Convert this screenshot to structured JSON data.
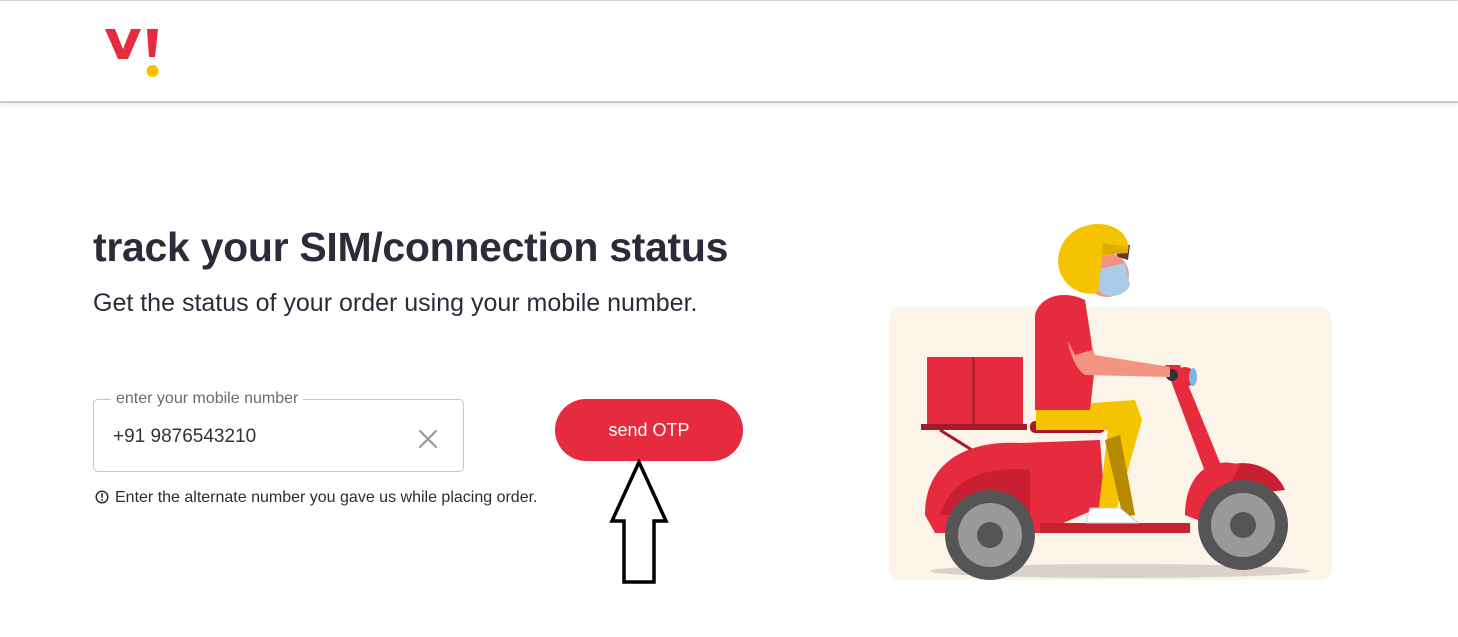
{
  "header": {
    "logo_icon": "vi-logo-icon",
    "brand_colors": {
      "red": "#e52b3d",
      "yellow": "#fdbf00"
    }
  },
  "main": {
    "title": "track your SIM/connection status",
    "subtitle": "Get the status of your order using your mobile number.",
    "mobile_field": {
      "label": "enter your mobile number",
      "value": "+91 9876543210",
      "clear_icon": "close-icon"
    },
    "hint": {
      "icon": "info-icon",
      "text": "Enter the alternate number you gave us while placing order."
    },
    "send_button": {
      "label": "send OTP",
      "color": "#e52b3d"
    },
    "annotation_icon": "arrow-up-icon",
    "illustration": "scooter-delivery-illustration"
  }
}
